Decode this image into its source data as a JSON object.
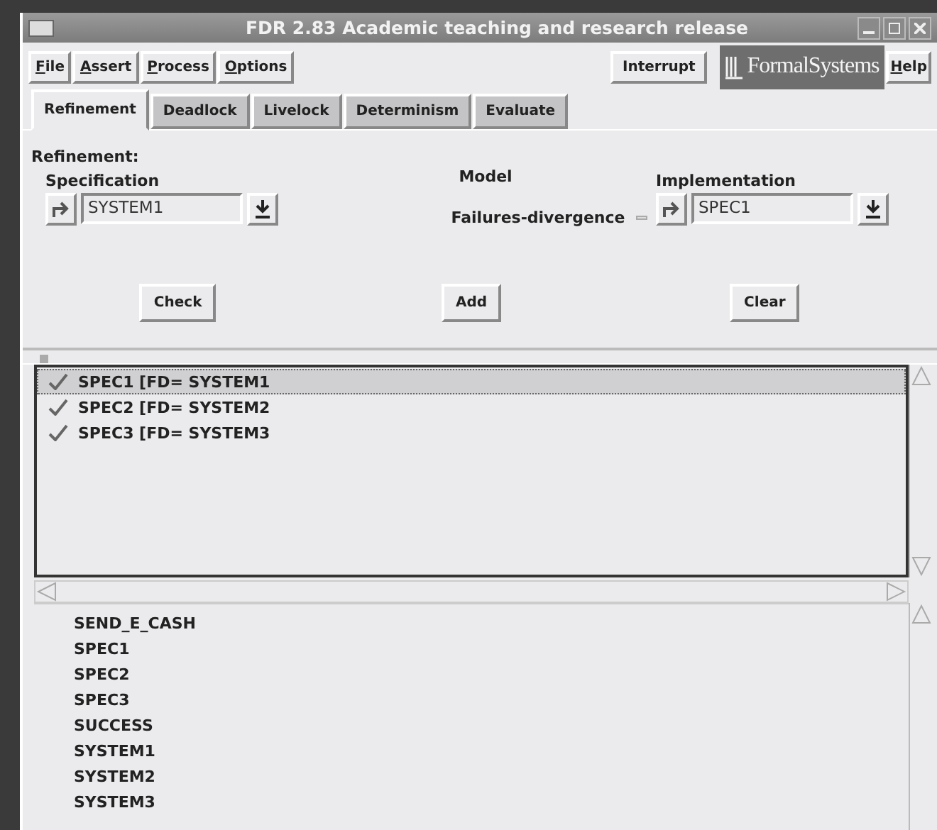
{
  "window": {
    "title": "FDR 2.83 Academic teaching and research release"
  },
  "menu": [
    "File",
    "Assert",
    "Process",
    "Options"
  ],
  "interrupt": "Interrupt",
  "logo": "FormalSystems",
  "help": "Help",
  "tabs": [
    {
      "label": "Refinement",
      "selected": true
    },
    {
      "label": "Deadlock",
      "selected": false
    },
    {
      "label": "Livelock",
      "selected": false
    },
    {
      "label": "Determinism",
      "selected": false
    },
    {
      "label": "Evaluate",
      "selected": false
    }
  ],
  "section_title": "Refinement:",
  "specification": {
    "label": "Specification",
    "value": "SYSTEM1"
  },
  "model": {
    "label": "Model",
    "value": "Failures-divergence"
  },
  "implementation": {
    "label": "Implementation",
    "value": "SPEC1"
  },
  "actions": [
    "Check",
    "Add",
    "Clear"
  ],
  "assertions": [
    {
      "text": "SPEC1 [FD= SYSTEM1",
      "passed": true,
      "selected": true
    },
    {
      "text": "SPEC2 [FD= SYSTEM2",
      "passed": true,
      "selected": false
    },
    {
      "text": "SPEC3 [FD= SYSTEM3",
      "passed": true,
      "selected": false
    }
  ],
  "processes": [
    "SEND_E_CASH",
    "SPEC1",
    "SPEC2",
    "SPEC3",
    "SUCCESS",
    "SYSTEM1",
    "SYSTEM2",
    "SYSTEM3"
  ]
}
